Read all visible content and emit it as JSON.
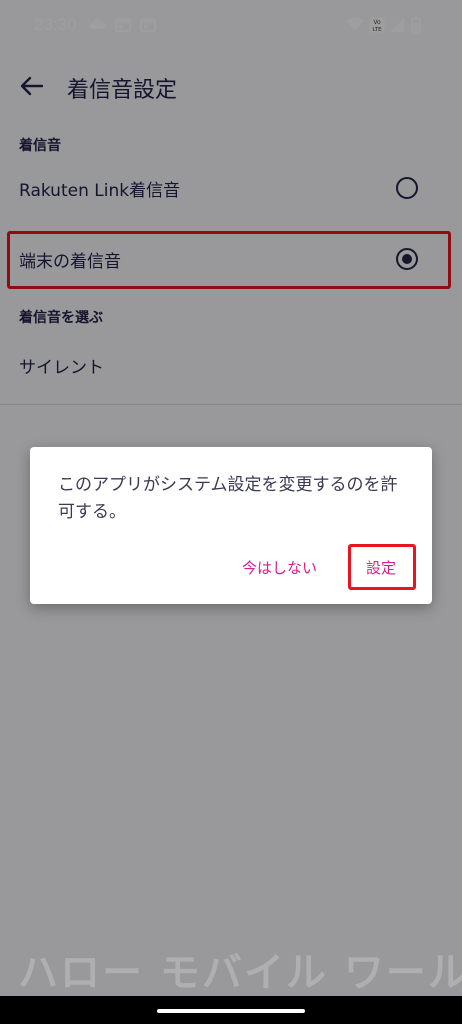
{
  "status_bar": {
    "time": "23:30",
    "icons": [
      "cloud-icon",
      "calendar-icon",
      "calendar-icon",
      "wifi-icon",
      "volte-icon",
      "signal-icon",
      "battery-icon"
    ]
  },
  "header": {
    "title": "着信音設定"
  },
  "sections": [
    {
      "header": "着信音",
      "items": [
        {
          "label": "Rakuten Link着信音",
          "selected": false
        },
        {
          "label": "端末の着信音",
          "selected": true
        }
      ]
    },
    {
      "header": "着信音を選ぶ",
      "items": [
        {
          "label": "サイレント"
        }
      ]
    }
  ],
  "dialog": {
    "message": "このアプリがシステム設定を変更するのを許可する。",
    "negative_label": "今はしない",
    "positive_label": "設定"
  },
  "watermark": "ハロー モバイル ワールド",
  "colors": {
    "text_primary": "#22234a",
    "accent": "#d61f8f",
    "highlight": "#e8141e"
  }
}
